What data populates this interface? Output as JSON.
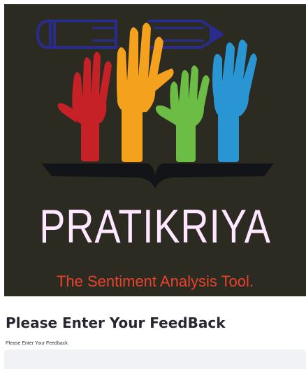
{
  "banner": {
    "brand_name": "PRATIKRIYA",
    "tagline": "The Sentiment Analysis Tool.",
    "image_name": "raised-hands-pencil-book-logo",
    "colors": {
      "background": "#2c2b22",
      "brand_text": "#ffe8ff",
      "tagline": "#e8422e",
      "hand_red": "#c52127",
      "hand_orange": "#f4a21d",
      "hand_green": "#6bbd45",
      "hand_blue": "#2a95d3",
      "pencil": "#2a2c8c",
      "book": "#121418"
    }
  },
  "form": {
    "title": "Please Enter Your FeedBack",
    "field_label": "Please Enter Your Feedback",
    "input_value": "",
    "input_placeholder": ""
  }
}
